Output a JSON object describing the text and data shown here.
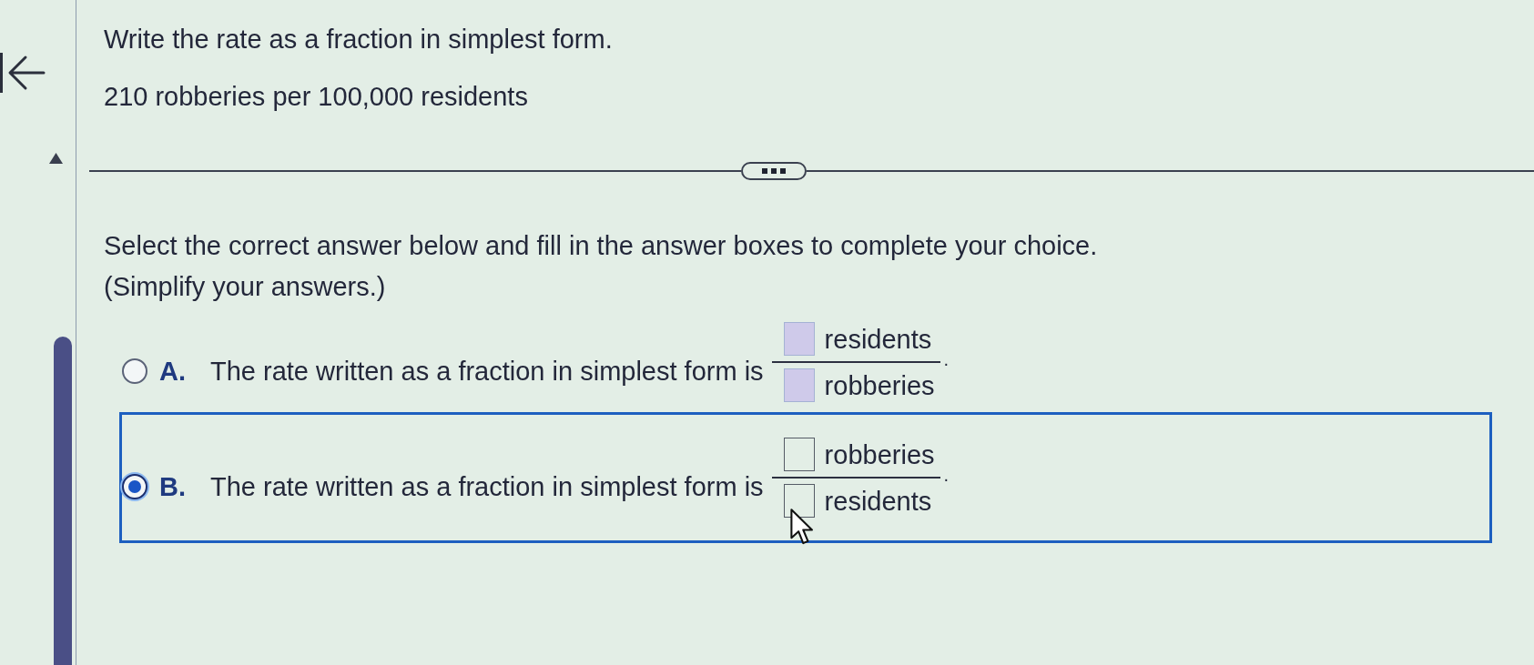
{
  "question": {
    "instruction": "Write the rate as a fraction in simplest form.",
    "rate": "210 robberies per 100,000 residents"
  },
  "prompt": {
    "instruction": "Select the correct answer below and fill in the answer boxes to complete your choice.",
    "note": "(Simplify your answers.)"
  },
  "options": [
    {
      "letter": "A.",
      "text": "The rate written as a fraction in simplest form is",
      "numerator_unit": "residents",
      "denominator_unit": "robberies",
      "end": ".",
      "selected": false
    },
    {
      "letter": "B.",
      "text": "The rate written as a fraction in simplest form is",
      "numerator_unit": "robberies",
      "denominator_unit": "residents",
      "end": ".",
      "selected": true
    }
  ]
}
